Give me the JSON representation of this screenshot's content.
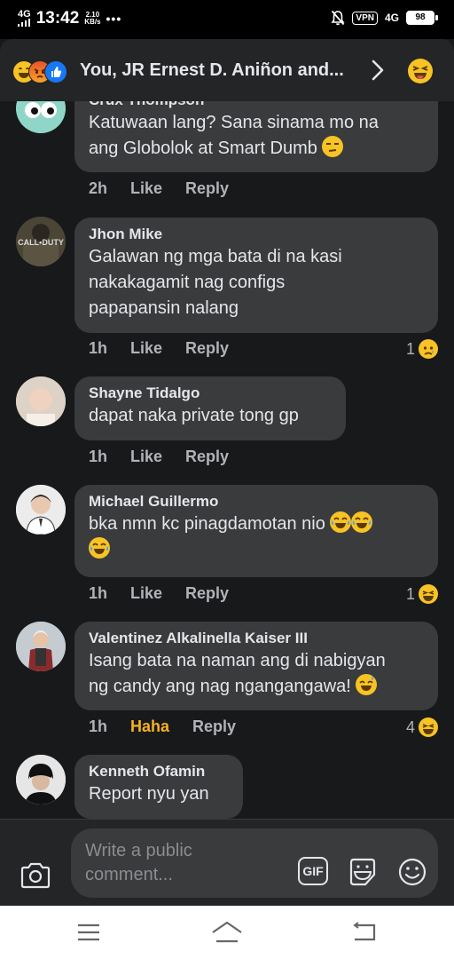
{
  "status_bar": {
    "network": "4G",
    "time": "13:42",
    "speed_value": "2.10",
    "speed_unit": "KB/s",
    "dots": "•••",
    "vpn": "VPN",
    "network_right": "4G",
    "battery": "98"
  },
  "header": {
    "title": "You, JR Ernest D. Aniñon and...",
    "reactions": [
      "haha-icon",
      "angry-icon",
      "like-icon"
    ]
  },
  "comments": [
    {
      "name": "Crux Thompson",
      "lines": [
        "Katuwaan lang? Sana sinama mo na",
        "ang Globolok at Smart Dumb"
      ],
      "time": "2h",
      "like": "Like",
      "reply": "Reply",
      "count": ""
    },
    {
      "name": "Jhon Mike",
      "lines": [
        "Galawan ng mga bata di na kasi",
        "nakakagamit nag configs",
        "papapansin nalang"
      ],
      "time": "1h",
      "like": "Like",
      "reply": "Reply",
      "count": "1"
    },
    {
      "name": "Shayne Tidalgo",
      "lines": [
        "dapat naka private tong gp"
      ],
      "time": "1h",
      "like": "Like",
      "reply": "Reply",
      "count": ""
    },
    {
      "name": "Michael Guillermo",
      "lines": [
        "bka nmn kc pinagdamotan nio"
      ],
      "time": "1h",
      "like": "Like",
      "reply": "Reply",
      "count": "1"
    },
    {
      "name": "Valentinez Alkalinella Kaiser III",
      "lines": [
        "Isang bata na naman ang di nabigyan",
        "ng candy ang nag ngangangawa!"
      ],
      "time": "1h",
      "like": "Haha",
      "reply": "Reply",
      "count": "4"
    },
    {
      "name": "Kenneth Ofamin",
      "lines": [
        "Report nyu yan"
      ],
      "time": "",
      "like": "",
      "reply": "",
      "count": ""
    }
  ],
  "composer": {
    "placeholder_line1": "Write a public",
    "placeholder_line2": "comment...",
    "gif_label": "GIF"
  },
  "avatar_badge_text": "CALL•DUTY",
  "colors": {
    "background": "#18191a",
    "bubble": "#3a3b3c",
    "haha_active": "#f7b125",
    "emoji_yellow": "#f7c325"
  }
}
